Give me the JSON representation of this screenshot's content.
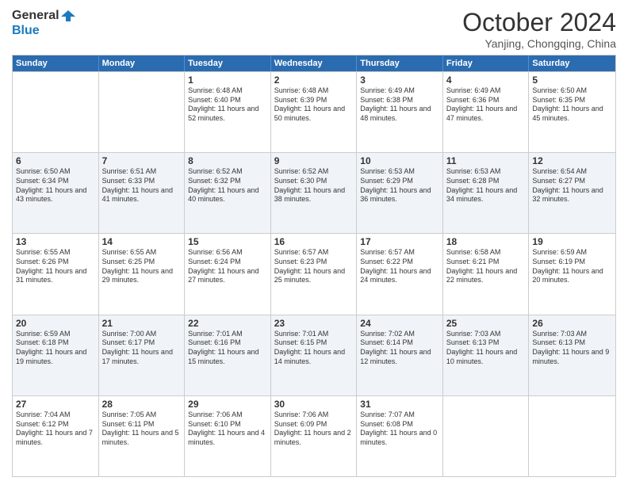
{
  "logo": {
    "line1": "General",
    "line2": "Blue"
  },
  "title": "October 2024",
  "subtitle": "Yanjing, Chongqing, China",
  "headers": [
    "Sunday",
    "Monday",
    "Tuesday",
    "Wednesday",
    "Thursday",
    "Friday",
    "Saturday"
  ],
  "rows": [
    [
      {
        "day": "",
        "sunrise": "",
        "sunset": "",
        "daylight": "",
        "alt": false
      },
      {
        "day": "",
        "sunrise": "",
        "sunset": "",
        "daylight": "",
        "alt": false
      },
      {
        "day": "1",
        "sunrise": "Sunrise: 6:48 AM",
        "sunset": "Sunset: 6:40 PM",
        "daylight": "Daylight: 11 hours and 52 minutes.",
        "alt": false
      },
      {
        "day": "2",
        "sunrise": "Sunrise: 6:48 AM",
        "sunset": "Sunset: 6:39 PM",
        "daylight": "Daylight: 11 hours and 50 minutes.",
        "alt": false
      },
      {
        "day": "3",
        "sunrise": "Sunrise: 6:49 AM",
        "sunset": "Sunset: 6:38 PM",
        "daylight": "Daylight: 11 hours and 48 minutes.",
        "alt": false
      },
      {
        "day": "4",
        "sunrise": "Sunrise: 6:49 AM",
        "sunset": "Sunset: 6:36 PM",
        "daylight": "Daylight: 11 hours and 47 minutes.",
        "alt": false
      },
      {
        "day": "5",
        "sunrise": "Sunrise: 6:50 AM",
        "sunset": "Sunset: 6:35 PM",
        "daylight": "Daylight: 11 hours and 45 minutes.",
        "alt": false
      }
    ],
    [
      {
        "day": "6",
        "sunrise": "Sunrise: 6:50 AM",
        "sunset": "Sunset: 6:34 PM",
        "daylight": "Daylight: 11 hours and 43 minutes.",
        "alt": true
      },
      {
        "day": "7",
        "sunrise": "Sunrise: 6:51 AM",
        "sunset": "Sunset: 6:33 PM",
        "daylight": "Daylight: 11 hours and 41 minutes.",
        "alt": true
      },
      {
        "day": "8",
        "sunrise": "Sunrise: 6:52 AM",
        "sunset": "Sunset: 6:32 PM",
        "daylight": "Daylight: 11 hours and 40 minutes.",
        "alt": true
      },
      {
        "day": "9",
        "sunrise": "Sunrise: 6:52 AM",
        "sunset": "Sunset: 6:30 PM",
        "daylight": "Daylight: 11 hours and 38 minutes.",
        "alt": true
      },
      {
        "day": "10",
        "sunrise": "Sunrise: 6:53 AM",
        "sunset": "Sunset: 6:29 PM",
        "daylight": "Daylight: 11 hours and 36 minutes.",
        "alt": true
      },
      {
        "day": "11",
        "sunrise": "Sunrise: 6:53 AM",
        "sunset": "Sunset: 6:28 PM",
        "daylight": "Daylight: 11 hours and 34 minutes.",
        "alt": true
      },
      {
        "day": "12",
        "sunrise": "Sunrise: 6:54 AM",
        "sunset": "Sunset: 6:27 PM",
        "daylight": "Daylight: 11 hours and 32 minutes.",
        "alt": true
      }
    ],
    [
      {
        "day": "13",
        "sunrise": "Sunrise: 6:55 AM",
        "sunset": "Sunset: 6:26 PM",
        "daylight": "Daylight: 11 hours and 31 minutes.",
        "alt": false
      },
      {
        "day": "14",
        "sunrise": "Sunrise: 6:55 AM",
        "sunset": "Sunset: 6:25 PM",
        "daylight": "Daylight: 11 hours and 29 minutes.",
        "alt": false
      },
      {
        "day": "15",
        "sunrise": "Sunrise: 6:56 AM",
        "sunset": "Sunset: 6:24 PM",
        "daylight": "Daylight: 11 hours and 27 minutes.",
        "alt": false
      },
      {
        "day": "16",
        "sunrise": "Sunrise: 6:57 AM",
        "sunset": "Sunset: 6:23 PM",
        "daylight": "Daylight: 11 hours and 25 minutes.",
        "alt": false
      },
      {
        "day": "17",
        "sunrise": "Sunrise: 6:57 AM",
        "sunset": "Sunset: 6:22 PM",
        "daylight": "Daylight: 11 hours and 24 minutes.",
        "alt": false
      },
      {
        "day": "18",
        "sunrise": "Sunrise: 6:58 AM",
        "sunset": "Sunset: 6:21 PM",
        "daylight": "Daylight: 11 hours and 22 minutes.",
        "alt": false
      },
      {
        "day": "19",
        "sunrise": "Sunrise: 6:59 AM",
        "sunset": "Sunset: 6:19 PM",
        "daylight": "Daylight: 11 hours and 20 minutes.",
        "alt": false
      }
    ],
    [
      {
        "day": "20",
        "sunrise": "Sunrise: 6:59 AM",
        "sunset": "Sunset: 6:18 PM",
        "daylight": "Daylight: 11 hours and 19 minutes.",
        "alt": true
      },
      {
        "day": "21",
        "sunrise": "Sunrise: 7:00 AM",
        "sunset": "Sunset: 6:17 PM",
        "daylight": "Daylight: 11 hours and 17 minutes.",
        "alt": true
      },
      {
        "day": "22",
        "sunrise": "Sunrise: 7:01 AM",
        "sunset": "Sunset: 6:16 PM",
        "daylight": "Daylight: 11 hours and 15 minutes.",
        "alt": true
      },
      {
        "day": "23",
        "sunrise": "Sunrise: 7:01 AM",
        "sunset": "Sunset: 6:15 PM",
        "daylight": "Daylight: 11 hours and 14 minutes.",
        "alt": true
      },
      {
        "day": "24",
        "sunrise": "Sunrise: 7:02 AM",
        "sunset": "Sunset: 6:14 PM",
        "daylight": "Daylight: 11 hours and 12 minutes.",
        "alt": true
      },
      {
        "day": "25",
        "sunrise": "Sunrise: 7:03 AM",
        "sunset": "Sunset: 6:13 PM",
        "daylight": "Daylight: 11 hours and 10 minutes.",
        "alt": true
      },
      {
        "day": "26",
        "sunrise": "Sunrise: 7:03 AM",
        "sunset": "Sunset: 6:13 PM",
        "daylight": "Daylight: 11 hours and 9 minutes.",
        "alt": true
      }
    ],
    [
      {
        "day": "27",
        "sunrise": "Sunrise: 7:04 AM",
        "sunset": "Sunset: 6:12 PM",
        "daylight": "Daylight: 11 hours and 7 minutes.",
        "alt": false
      },
      {
        "day": "28",
        "sunrise": "Sunrise: 7:05 AM",
        "sunset": "Sunset: 6:11 PM",
        "daylight": "Daylight: 11 hours and 5 minutes.",
        "alt": false
      },
      {
        "day": "29",
        "sunrise": "Sunrise: 7:06 AM",
        "sunset": "Sunset: 6:10 PM",
        "daylight": "Daylight: 11 hours and 4 minutes.",
        "alt": false
      },
      {
        "day": "30",
        "sunrise": "Sunrise: 7:06 AM",
        "sunset": "Sunset: 6:09 PM",
        "daylight": "Daylight: 11 hours and 2 minutes.",
        "alt": false
      },
      {
        "day": "31",
        "sunrise": "Sunrise: 7:07 AM",
        "sunset": "Sunset: 6:08 PM",
        "daylight": "Daylight: 11 hours and 0 minutes.",
        "alt": false
      },
      {
        "day": "",
        "sunrise": "",
        "sunset": "",
        "daylight": "",
        "alt": false
      },
      {
        "day": "",
        "sunrise": "",
        "sunset": "",
        "daylight": "",
        "alt": false
      }
    ]
  ]
}
